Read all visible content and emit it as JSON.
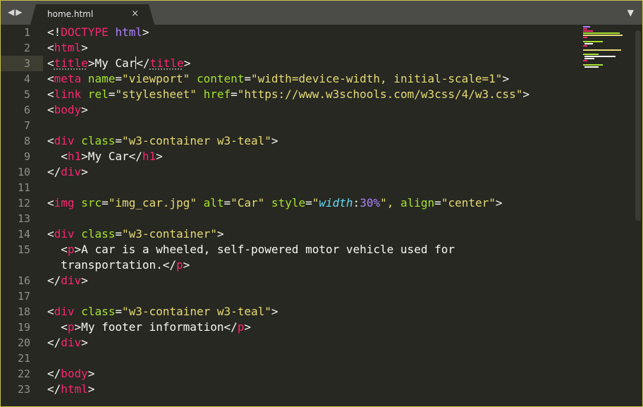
{
  "tab": {
    "title": "home.html",
    "close": "×"
  },
  "nav": {
    "back": "◀",
    "forward": "▶"
  },
  "menu": {
    "arrow": "▼"
  },
  "line_numbers": [
    "1",
    "2",
    "3",
    "4",
    "5",
    "6",
    "7",
    "8",
    "9",
    "10",
    "11",
    "12",
    "13",
    "14",
    "15",
    "16",
    "17",
    "18",
    "19",
    "20",
    "21",
    "22",
    "23"
  ],
  "code": {
    "l1": {
      "p1": "<!",
      "p2": "DOCTYPE",
      "p3": " html",
      "p4": ">"
    },
    "l2": {
      "p1": "<",
      "p2": "html",
      "p3": ">"
    },
    "l3": {
      "p1": "<",
      "p2": "title",
      "p3": ">My Car",
      "p4": "</",
      "p5": "title",
      "p6": ">"
    },
    "l4": {
      "p1": "<",
      "p2": "meta",
      "p3": " name",
      "p4": "=",
      "p5": "\"viewport\"",
      "p6": " content",
      "p7": "=",
      "p8": "\"width=device-width, initial-scale=1\"",
      "p9": ">"
    },
    "l5": {
      "p1": "<",
      "p2": "link",
      "p3": " rel",
      "p4": "=",
      "p5": "\"stylesheet\"",
      "p6": " href",
      "p7": "=",
      "p8": "\"https://www.w3schools.com/w3css/4/w3.css\"",
      "p9": ">"
    },
    "l6": {
      "p1": "<",
      "p2": "body",
      "p3": ">"
    },
    "l8": {
      "p1": "<",
      "p2": "div",
      "p3": " class",
      "p4": "=",
      "p5": "\"w3-container w3-teal\"",
      "p6": ">"
    },
    "l9": {
      "p1": "  <",
      "p2": "h1",
      "p3": ">My Car</",
      "p4": "h1",
      "p5": ">"
    },
    "l10": {
      "p1": "</",
      "p2": "div",
      "p3": ">"
    },
    "l12": {
      "p1": "<",
      "p2": "img",
      "p3": " src",
      "p4": "=",
      "p5": "\"img_car.jpg\"",
      "p6": " alt",
      "p7": "=",
      "p8": "\"Car\"",
      "p9": " style",
      "p10": "=",
      "p11": "\"",
      "p12": "width",
      "p13": ":",
      "p14": "30%",
      "p15": "\"",
      "p16": ", ",
      "p17": "align",
      "p18": "=",
      "p19": "\"center\"",
      "p20": ">"
    },
    "l14": {
      "p1": "<",
      "p2": "div",
      "p3": " class",
      "p4": "=",
      "p5": "\"w3-container\"",
      "p6": ">"
    },
    "l15a": {
      "p1": "  <",
      "p2": "p",
      "p3": ">A car is a wheeled, self-powered motor vehicle used for"
    },
    "l15b": {
      "p1": "  transportation.</",
      "p2": "p",
      "p3": ">"
    },
    "l16": {
      "p1": "</",
      "p2": "div",
      "p3": ">"
    },
    "l18": {
      "p1": "<",
      "p2": "div",
      "p3": " class",
      "p4": "=",
      "p5": "\"w3-container w3-teal\"",
      "p6": ">"
    },
    "l19": {
      "p1": "  <",
      "p2": "p",
      "p3": ">My footer information</",
      "p4": "p",
      "p5": ">"
    },
    "l20": {
      "p1": "</",
      "p2": "div",
      "p3": ">"
    },
    "l22": {
      "p1": "</",
      "p2": "body",
      "p3": ">"
    },
    "l23": {
      "p1": "</",
      "p2": "html",
      "p3": ">"
    }
  },
  "colors": {
    "background": "#272822",
    "tag": "#f92672",
    "attribute": "#a6e22e",
    "string": "#e6db74",
    "keyword": "#ae81ff",
    "css_property": "#66d9ef",
    "text": "#f8f8f2",
    "line_number": "#8f908a",
    "current_line": "#3e3d32"
  }
}
